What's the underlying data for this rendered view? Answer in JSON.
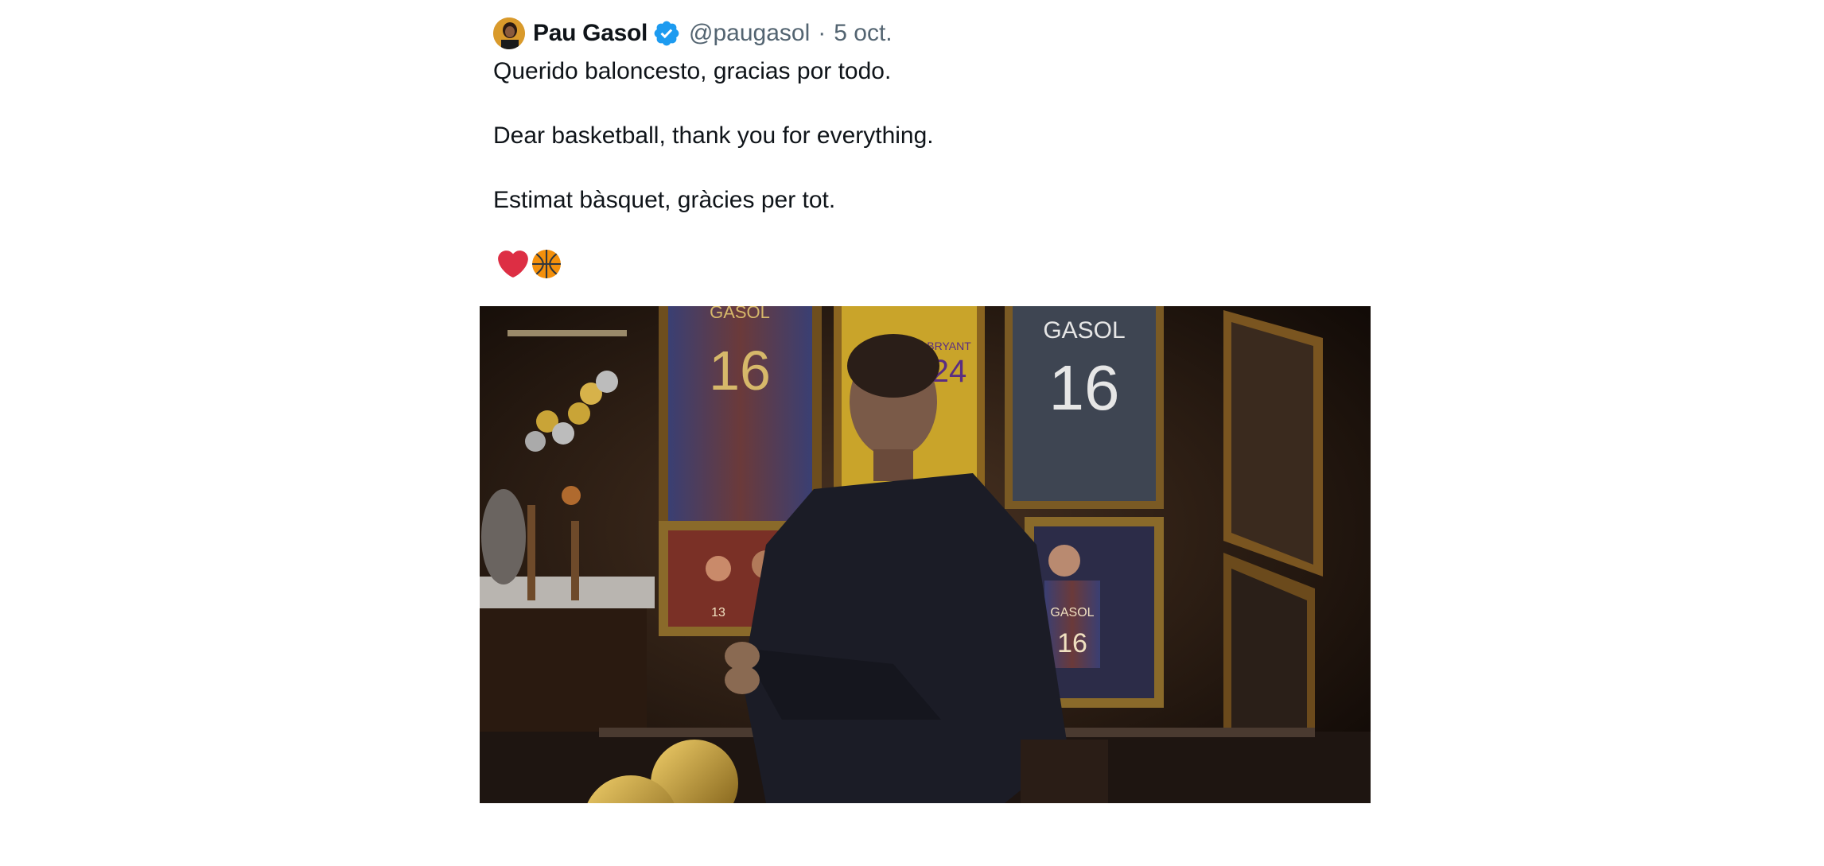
{
  "tweet": {
    "author": {
      "display_name": "Pau Gasol",
      "handle": "@paugasol",
      "verified": true,
      "avatar_icon": "profile-photo"
    },
    "separator": "·",
    "date": "5 oct.",
    "text_lines": [
      "Querido baloncesto, gracias por todo.",
      "Dear basketball, thank you for everything.",
      "Estimat bàsquet, gràcies per tot."
    ],
    "emojis": [
      "red-heart-icon",
      "basketball-icon"
    ],
    "media": {
      "type": "photo",
      "jersey_labels": [
        "GASOL",
        "16",
        "GASOL",
        "16",
        "BRYANT",
        "24",
        "GASOL",
        "16",
        "13"
      ]
    }
  },
  "colors": {
    "text_primary": "#0f1419",
    "text_secondary": "#536471",
    "verified_blue": "#1d9bf0",
    "heart_red": "#dd2e44",
    "basketball_orange": "#f4900c"
  }
}
